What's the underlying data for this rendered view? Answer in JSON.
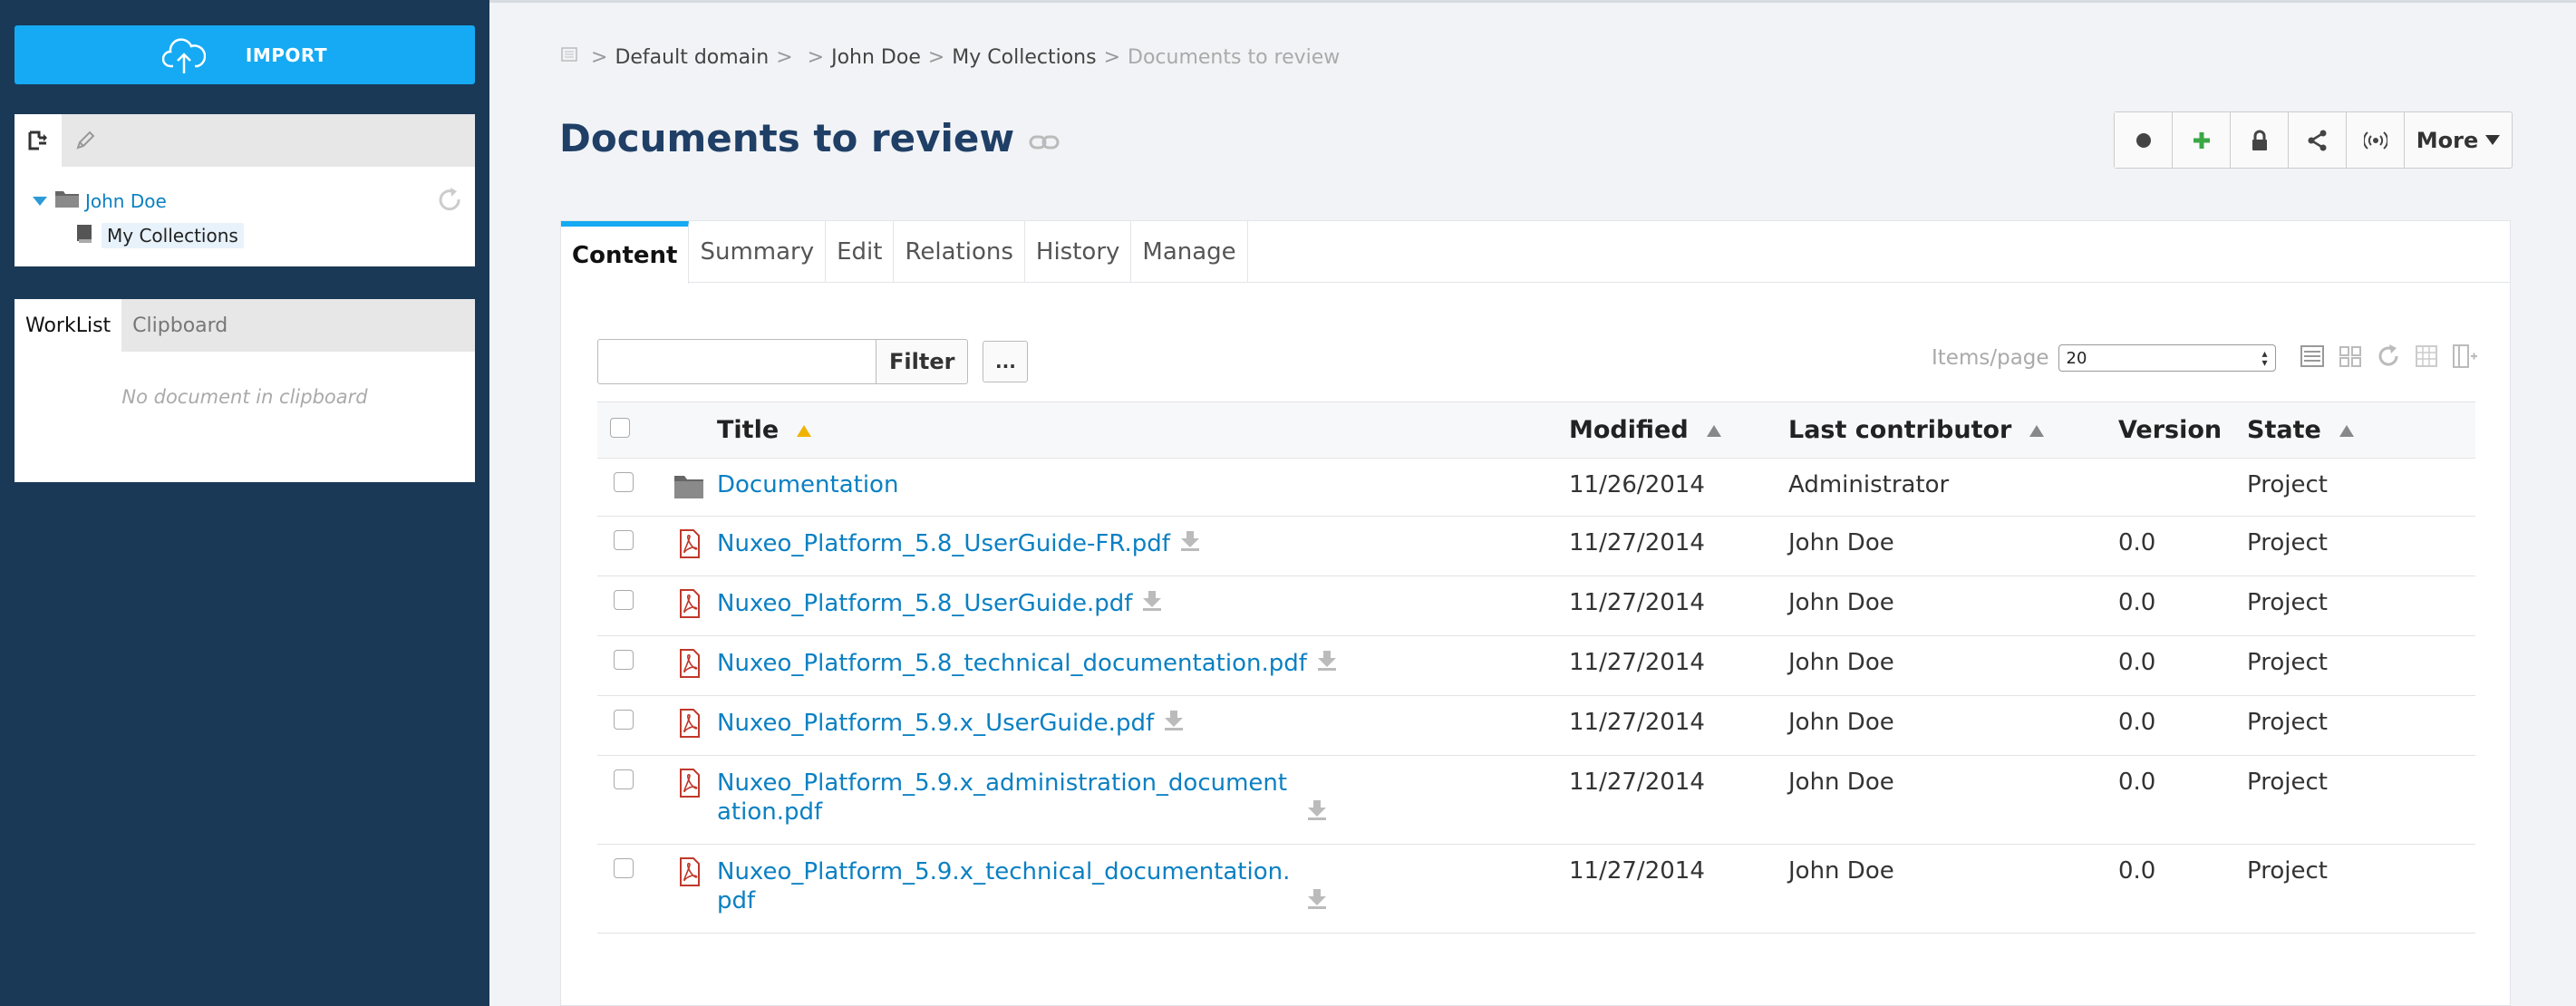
{
  "sidebar": {
    "import_label": "IMPORT",
    "tree": {
      "root_label": "John Doe",
      "child_label": "My Collections"
    },
    "clipboard": {
      "tabs": [
        "WorkList",
        "Clipboard"
      ],
      "empty_message": "No document in clipboard"
    }
  },
  "breadcrumb": {
    "items": [
      "Default domain",
      "John Doe",
      "My Collections"
    ],
    "current": "Documents to review",
    "sep": ">"
  },
  "page": {
    "title": "Documents to review"
  },
  "actions": {
    "more_label": "More"
  },
  "tabs": [
    "Content",
    "Summary",
    "Edit",
    "Relations",
    "History",
    "Manage"
  ],
  "filter": {
    "value": "",
    "button_label": "Filter",
    "more_label": "..."
  },
  "paging": {
    "label": "Items/page",
    "value": "20"
  },
  "table": {
    "headers": {
      "title": "Title",
      "modified": "Modified",
      "contributor": "Last contributor",
      "version": "Version",
      "state": "State"
    },
    "rows": [
      {
        "type": "folder",
        "title": "Documentation",
        "modified": "11/26/2014",
        "contributor": "Administrator",
        "version": "",
        "state": "Project"
      },
      {
        "type": "pdf",
        "title": "Nuxeo_Platform_5.8_UserGuide-FR.pdf",
        "modified": "11/27/2014",
        "contributor": "John Doe",
        "version": "0.0",
        "state": "Project"
      },
      {
        "type": "pdf",
        "title": "Nuxeo_Platform_5.8_UserGuide.pdf",
        "modified": "11/27/2014",
        "contributor": "John Doe",
        "version": "0.0",
        "state": "Project"
      },
      {
        "type": "pdf",
        "title": "Nuxeo_Platform_5.8_technical_documentation.pdf",
        "modified": "11/27/2014",
        "contributor": "John Doe",
        "version": "0.0",
        "state": "Project"
      },
      {
        "type": "pdf",
        "title": "Nuxeo_Platform_5.9.x_UserGuide.pdf",
        "modified": "11/27/2014",
        "contributor": "John Doe",
        "version": "0.0",
        "state": "Project"
      },
      {
        "type": "pdf",
        "title": "Nuxeo_Platform_5.9.x_administration_documentation.pdf",
        "modified": "11/27/2014",
        "contributor": "John Doe",
        "version": "0.0",
        "state": "Project"
      },
      {
        "type": "pdf",
        "title": "Nuxeo_Platform_5.9.x_technical_documentation.pdf",
        "modified": "11/27/2014",
        "contributor": "John Doe",
        "version": "0.0",
        "state": "Project"
      }
    ]
  },
  "colors": {
    "sidebar_bg": "#1a3957",
    "accent": "#15aaf3",
    "link": "#0b80c2",
    "title": "#1f3f66"
  }
}
